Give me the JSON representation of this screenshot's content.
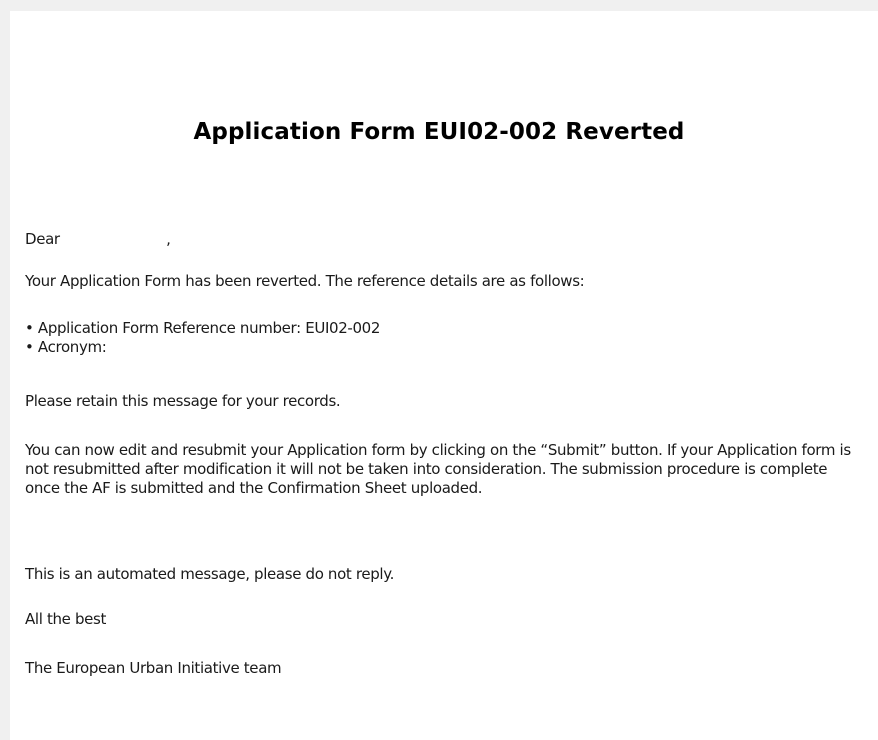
{
  "email": {
    "title": "Application Form EUI02-002 Reverted",
    "greeting_prefix": "Dear",
    "greeting_name": "",
    "greeting_suffix": ",",
    "intro": "Your Application Form has been reverted. The reference details are as follows:",
    "details": [
      "Application Form Reference number: EUI02-002",
      "Acronym:"
    ],
    "retain_note": "Please retain this message for your records.",
    "instructions": "You can now edit and resubmit your Application form by clicking on the “Submit” button. If your Application form is not resubmitted after modification it will not be taken into consideration. The submission procedure is complete once the AF is submitted and the Confirmation Sheet uploaded.",
    "automated_note": "This is an automated message, please do not reply.",
    "closing": "All the best",
    "signature": "The European Urban Initiative team"
  }
}
